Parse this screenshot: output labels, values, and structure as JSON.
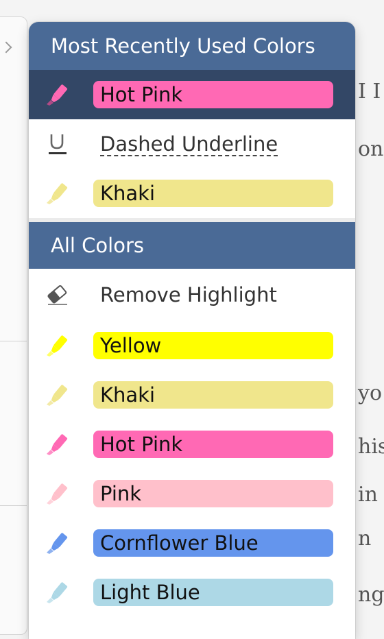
{
  "background": {
    "text_fragments": [
      "I I",
      "on",
      "yo",
      "his",
      "in",
      "n",
      "ng"
    ]
  },
  "menu": {
    "recent_header": "Most Recently Used Colors",
    "recent_items": [
      {
        "label": "Hot Pink",
        "color": "#ff69b4",
        "icon": "highlighter-icon",
        "selected": true
      },
      {
        "label": "Dashed Underline",
        "color": "",
        "icon": "underline-icon",
        "selected": false
      },
      {
        "label": "Khaki",
        "color": "#f0e68c",
        "icon": "highlighter-icon",
        "selected": false
      }
    ],
    "all_header": "All Colors",
    "remove_label": "Remove Highlight",
    "all_items": [
      {
        "label": "Yellow",
        "color": "#ffff00",
        "icon": "highlighter-icon"
      },
      {
        "label": "Khaki",
        "color": "#f0e68c",
        "icon": "highlighter-icon"
      },
      {
        "label": "Hot Pink",
        "color": "#ff69b4",
        "icon": "highlighter-icon"
      },
      {
        "label": "Pink",
        "color": "#ffc0cb",
        "icon": "highlighter-icon"
      },
      {
        "label": "Cornflower Blue",
        "color": "#6495ed",
        "icon": "highlighter-icon"
      },
      {
        "label": "Light Blue",
        "color": "#add8e6",
        "icon": "highlighter-icon"
      }
    ],
    "accent_header_color": "#4a6a96",
    "selected_row_color": "#334766"
  }
}
